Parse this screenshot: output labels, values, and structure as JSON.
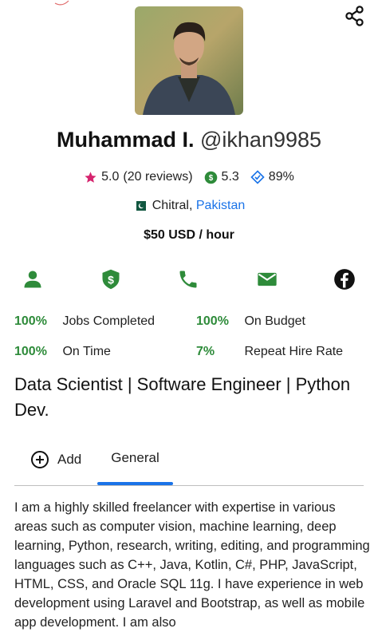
{
  "profile": {
    "name": "Muhammad I.",
    "handle": "@ikhan9985",
    "rating": "5.0",
    "reviews": "(20 reviews)",
    "earnings_score": "5.3",
    "completion_score": "89%",
    "city": "Chitral,",
    "country": "Pakistan",
    "hourly_rate": "$50 USD / hour"
  },
  "contact_icons": [
    "person-icon",
    "verified-payment-icon",
    "phone-icon",
    "email-icon",
    "facebook-icon"
  ],
  "stats": [
    {
      "pct": "100%",
      "label": "Jobs Completed"
    },
    {
      "pct": "100%",
      "label": "On Budget"
    },
    {
      "pct": "100%",
      "label": "On Time"
    },
    {
      "pct": "7%",
      "label": "Repeat Hire Rate"
    }
  ],
  "headline": "Data Scientist | Software Engineer | Python Dev.",
  "tabs": {
    "add": "Add",
    "general": "General"
  },
  "bio": "I am a highly skilled freelancer with expertise in various areas such as computer vision, machine learning, deep learning, Python, research, writing, editing, and programming languages such as C++, Java, Kotlin, C#, PHP, JavaScript, HTML, CSS, and Oracle SQL 11g. I have experience in web development using Laravel and Bootstrap, as well as mobile app development. I am also",
  "colors": {
    "accent": "#1a73e8",
    "success": "#2e8b3a",
    "star": "#d6246e"
  }
}
